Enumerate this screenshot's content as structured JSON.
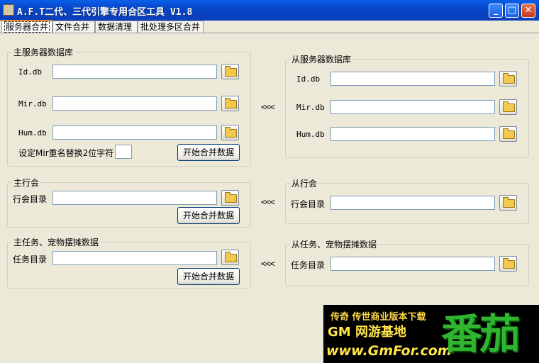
{
  "window": {
    "title": "A.F.T二代、三代引擎专用合区工具 V1.8",
    "controls": [
      "minimize",
      "maximize",
      "close"
    ]
  },
  "tabs": [
    {
      "label": "服务器合并",
      "active": true
    },
    {
      "label": "文件合并",
      "active": false
    },
    {
      "label": "数据清理",
      "active": false
    },
    {
      "label": "批处理多区合并",
      "active": false
    }
  ],
  "master_db": {
    "title": "主服务器数据库",
    "fields": [
      {
        "label": "Id.db",
        "value": ""
      },
      {
        "label": "Mir.db",
        "value": ""
      },
      {
        "label": "Hum.db",
        "value": ""
      }
    ],
    "rename_label": "设定Mir重名替换2位字符",
    "rename_value": "",
    "start_button": "开始合并数据"
  },
  "slave_db": {
    "title": "从服务器数据库",
    "fields": [
      {
        "label": "Id.db",
        "value": ""
      },
      {
        "label": "Mir.db",
        "value": ""
      },
      {
        "label": "Hum.db",
        "value": ""
      }
    ]
  },
  "master_guild": {
    "title": "主行会",
    "dir_label": "行会目录",
    "value": "",
    "start_button": "开始合并数据"
  },
  "slave_guild": {
    "title": "从行会",
    "dir_label": "行会目录",
    "value": ""
  },
  "master_task": {
    "title": "主任务、宠物摆摊数据",
    "dir_label": "任务目录",
    "value": "",
    "start_button": "开始合并数据"
  },
  "slave_task": {
    "title": "从任务、宠物摆摊数据",
    "dir_label": "任务目录",
    "value": ""
  },
  "merge_arrow": "<<<",
  "banner": {
    "line1": "传奇 传世商业版本下载",
    "line2": "GM 网游基地",
    "line3": "www.GmFor.com",
    "logo": "番茄"
  }
}
